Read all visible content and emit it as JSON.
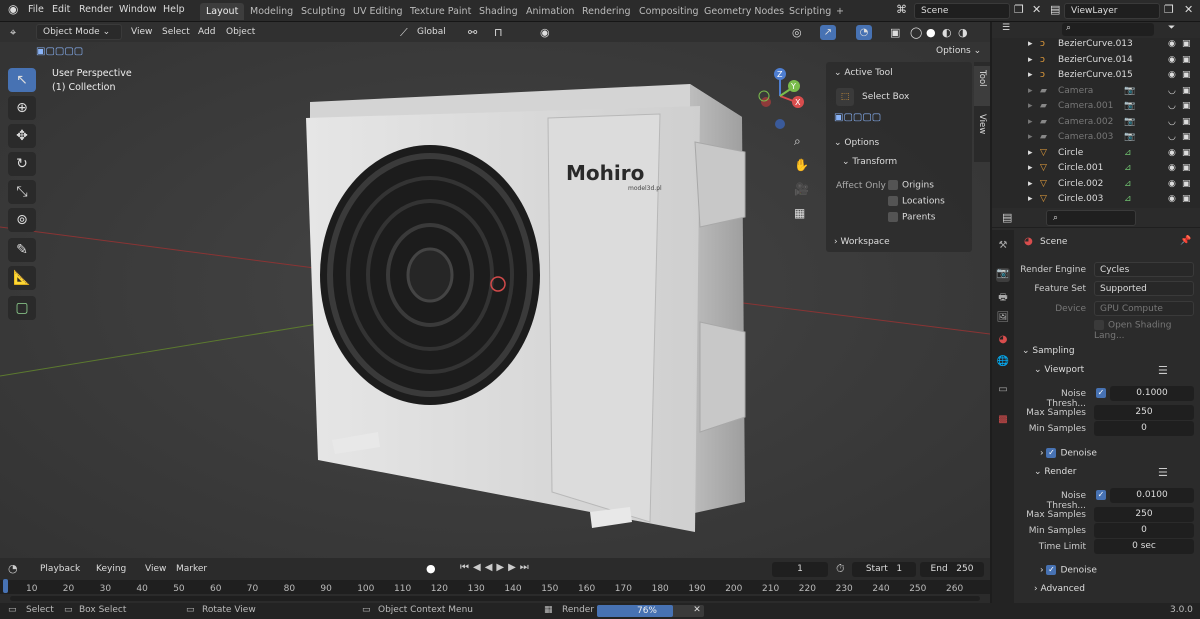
{
  "menus": [
    "File",
    "Edit",
    "Render",
    "Window",
    "Help"
  ],
  "workspaces": [
    "Layout",
    "Modeling",
    "Sculpting",
    "UV Editing",
    "Texture Paint",
    "Shading",
    "Animation",
    "Rendering",
    "Compositing",
    "Geometry Nodes",
    "Scripting"
  ],
  "add_tab": "+",
  "scene_name": "Scene",
  "viewlayer_name": "ViewLayer",
  "viewport": {
    "mode": "Object Mode",
    "menus": [
      "View",
      "Select",
      "Add",
      "Object"
    ],
    "transform_orientation": "Global",
    "options_label": "Options",
    "overlay_title": "User Perspective",
    "overlay_sub": "(1) Collection",
    "gizmo_axes": [
      "Z",
      "Y",
      "X"
    ],
    "model_brand": "Mohiro",
    "model_sub": "model3d.pl"
  },
  "npanel": {
    "active_tool_header": "Active Tool",
    "tool_name": "Select Box",
    "options_header": "Options",
    "transform_header": "Transform",
    "affect_only": "Affect Only",
    "affect_items": [
      "Origins",
      "Locations",
      "Parents"
    ],
    "workspace_header": "Workspace",
    "tabs": [
      "Tool",
      "View"
    ]
  },
  "outliner": {
    "items": [
      {
        "name": "BezierCurve.013",
        "dim": false,
        "type": "curve"
      },
      {
        "name": "BezierCurve.014",
        "dim": false,
        "type": "curve"
      },
      {
        "name": "BezierCurve.015",
        "dim": false,
        "type": "curve"
      },
      {
        "name": "Camera",
        "dim": true,
        "type": "camera"
      },
      {
        "name": "Camera.001",
        "dim": true,
        "type": "camera"
      },
      {
        "name": "Camera.002",
        "dim": true,
        "type": "camera"
      },
      {
        "name": "Camera.003",
        "dim": true,
        "type": "camera"
      },
      {
        "name": "Circle",
        "dim": false,
        "type": "mesh"
      },
      {
        "name": "Circle.001",
        "dim": false,
        "type": "mesh"
      },
      {
        "name": "Circle.002",
        "dim": false,
        "type": "mesh"
      },
      {
        "name": "Circle.003",
        "dim": false,
        "type": "mesh"
      }
    ]
  },
  "properties": {
    "context": "Scene",
    "render_engine_label": "Render Engine",
    "render_engine": "Cycles",
    "feature_set_label": "Feature Set",
    "feature_set": "Supported",
    "device_label": "Device",
    "device": "GPU Compute",
    "osl_label": "Open Shading Lang...",
    "sampling": "Sampling",
    "viewport_section": "Viewport",
    "v_noise_label": "Noise Thresh...",
    "v_noise": "0.1000",
    "v_max_label": "Max Samples",
    "v_max": "250",
    "v_min_label": "Min Samples",
    "v_min": "0",
    "denoise_label": "Denoise",
    "render_section": "Render",
    "r_noise_label": "Noise Thresh...",
    "r_noise": "0.0100",
    "r_max_label": "Max Samples",
    "r_max": "250",
    "r_min_label": "Min Samples",
    "r_min": "0",
    "time_limit_label": "Time Limit",
    "time_limit": "0 sec",
    "advanced": "Advanced"
  },
  "timeline": {
    "menus": [
      "Playback",
      "Keying",
      "View",
      "Marker"
    ],
    "current_frame": "1",
    "start_label": "Start",
    "start": "1",
    "end_label": "End",
    "end": "250",
    "ticks": [
      "10",
      "20",
      "30",
      "40",
      "50",
      "60",
      "70",
      "80",
      "90",
      "100",
      "110",
      "120",
      "130",
      "140",
      "150",
      "160",
      "170",
      "180",
      "190",
      "200",
      "210",
      "220",
      "230",
      "240",
      "250",
      "260"
    ]
  },
  "status": {
    "select": "Select",
    "box_select": "Box Select",
    "rotate_view": "Rotate View",
    "context_menu": "Object Context Menu",
    "render_label": "Render",
    "render_progress_text": "76%",
    "render_progress": 0.76,
    "version": "3.0.0"
  },
  "colors": {
    "accent": "#4772b3",
    "orange": "#e8a03c",
    "green": "#6fc06f"
  }
}
